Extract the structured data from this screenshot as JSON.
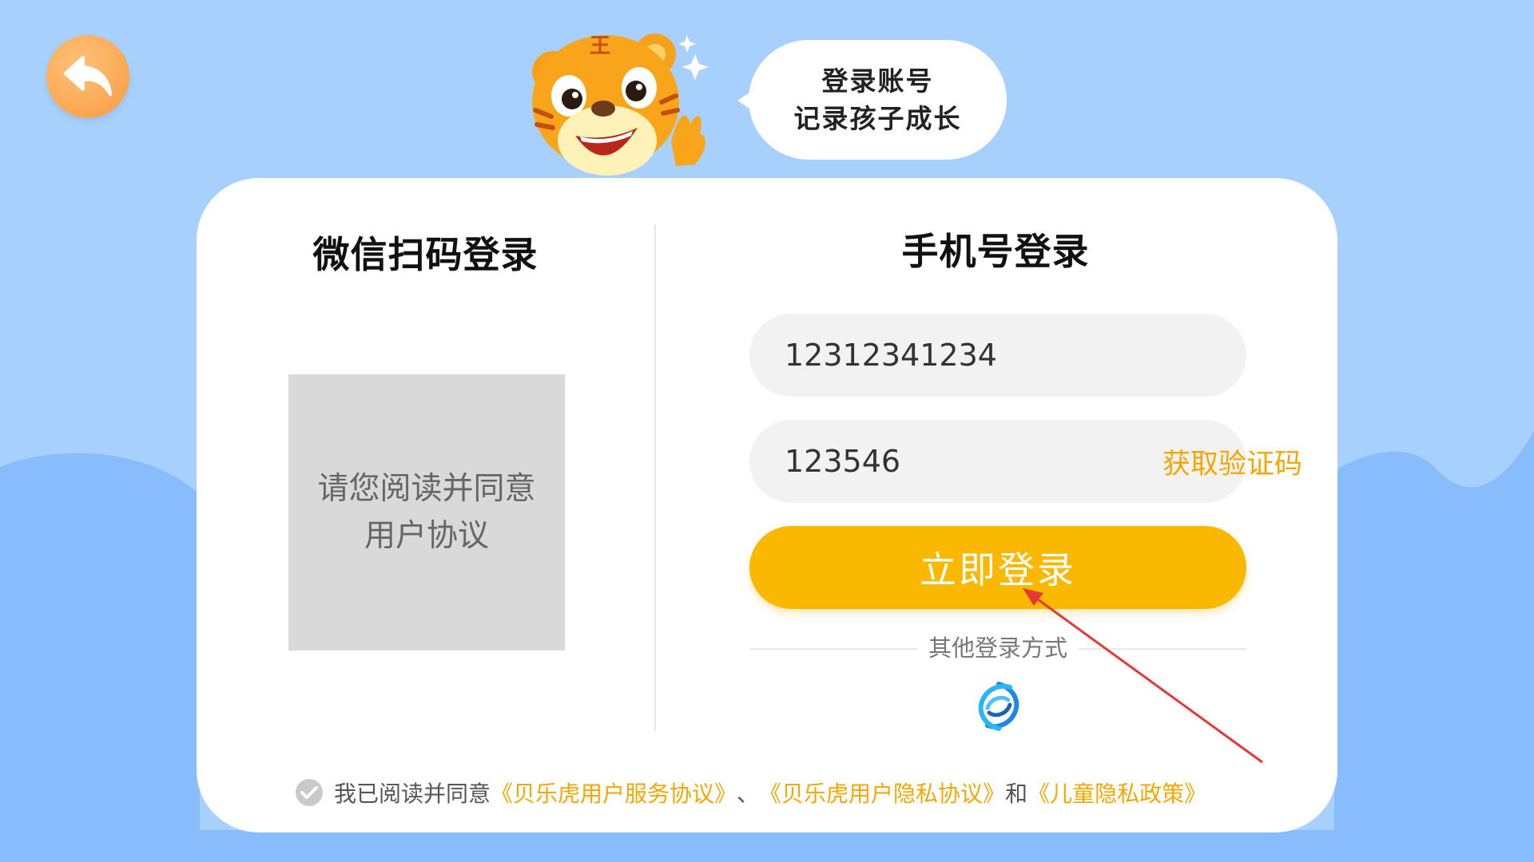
{
  "bubble": {
    "line1": "登录账号",
    "line2": "记录孩子成长"
  },
  "wechat": {
    "title": "微信扫码登录",
    "qr_placeholder": "请您阅读并同意用户协议"
  },
  "phone": {
    "title": "手机号登录",
    "phone_value": "12312341234",
    "code_value": "123546",
    "get_code_label": "获取验证码",
    "login_label": "立即登录",
    "other_methods_label": "其他登录方式"
  },
  "agreement": {
    "prefix": "我已阅读并同意",
    "service_link": "《贝乐虎用户服务协议》",
    "separator": "、",
    "privacy_link": "《贝乐虎用户隐私协议》",
    "and": "和",
    "children_link": "《儿童隐私政策》",
    "checked": true
  },
  "icons": {
    "back": "back-arrow-icon",
    "mascot": "tiger-mascot",
    "carrier": "china-mobile-icon",
    "check": "check-circle-icon"
  },
  "colors": {
    "background": "#a8d0fd",
    "accent": "#fbb800",
    "link": "#f5a700",
    "back_button": "#f89a3f"
  }
}
